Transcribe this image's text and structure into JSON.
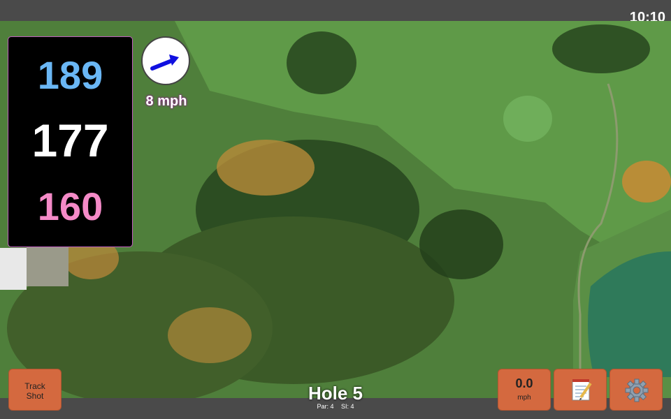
{
  "clock": "10:10",
  "distances": {
    "back": "189",
    "center": "177",
    "front": "160"
  },
  "wind": {
    "speed_label": "8 mph",
    "icon": "wind-arrow-icon",
    "arrow_color": "#1010e0"
  },
  "hole": {
    "title": "Hole 5",
    "par": "Par: 4",
    "si": "SI: 4"
  },
  "buttons": {
    "track_shot_line1": "Track",
    "track_shot_line2": "Shot",
    "speed_value": "0.0",
    "speed_unit": "mph",
    "notes_icon": "notepad-icon",
    "settings_icon": "gear-icon"
  },
  "colors": {
    "button": "#d4693f",
    "back_distance": "#6ab7f5",
    "center_distance": "#ffffff",
    "front_distance": "#f48ac7",
    "panel_border": "#c060c0"
  }
}
